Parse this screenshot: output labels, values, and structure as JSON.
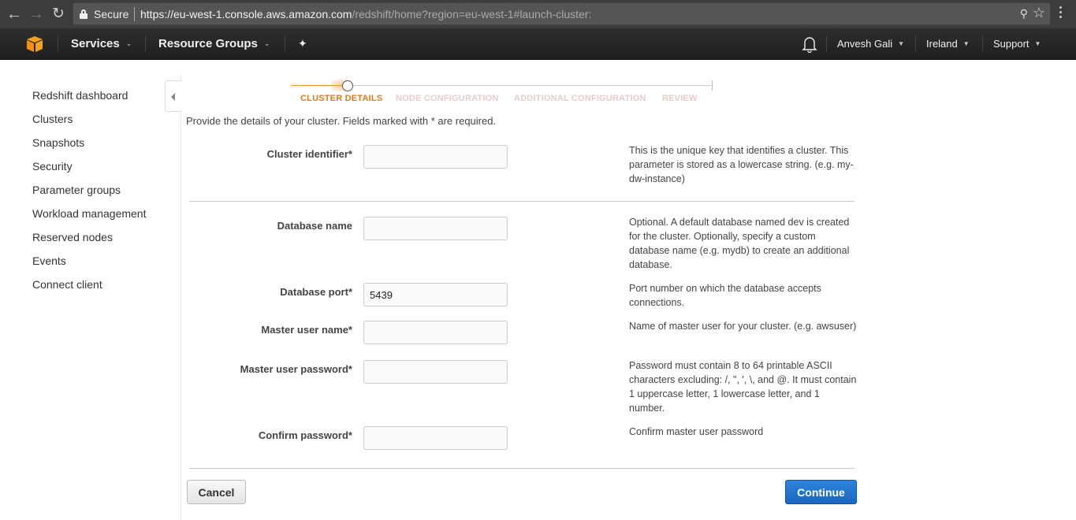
{
  "browser": {
    "secure_label": "Secure",
    "url_host": "https://eu-west-1.console.aws.amazon.com",
    "url_path": "/redshift/home?region=eu-west-1#launch-cluster:"
  },
  "topnav": {
    "services": "Services",
    "resource_groups": "Resource Groups",
    "user": "Anvesh Gali",
    "region": "Ireland",
    "support": "Support"
  },
  "sidebar": {
    "items": [
      {
        "label": "Redshift dashboard"
      },
      {
        "label": "Clusters"
      },
      {
        "label": "Snapshots"
      },
      {
        "label": "Security"
      },
      {
        "label": "Parameter groups"
      },
      {
        "label": "Workload management"
      },
      {
        "label": "Reserved nodes"
      },
      {
        "label": "Events"
      },
      {
        "label": "Connect client"
      }
    ]
  },
  "wizard": {
    "steps": [
      {
        "label": "CLUSTER DETAILS",
        "state": "active"
      },
      {
        "label": "NODE CONFIGURATION",
        "state": "inactive"
      },
      {
        "label": "ADDITIONAL CONFIGURATION",
        "state": "inactive"
      },
      {
        "label": "REVIEW",
        "state": "inactive"
      }
    ],
    "accent_color": "#e07b1c"
  },
  "form": {
    "intro": "Provide the details of your cluster. Fields marked with * are required.",
    "fields": [
      {
        "label": "Cluster identifier*",
        "value": "",
        "help": "This is the unique key that identifies a cluster. This parameter is stored as a lowercase string. (e.g. my-dw-instance)"
      },
      {
        "label": "Database name",
        "value": "",
        "help": "Optional. A default database named dev is created for the cluster. Optionally, specify a custom database name (e.g. mydb) to create an additional database."
      },
      {
        "label": "Database port*",
        "value": "5439",
        "help": "Port number on which the database accepts connections."
      },
      {
        "label": "Master user name*",
        "value": "",
        "help": "Name of master user for your cluster. (e.g. awsuser)"
      },
      {
        "label": "Master user password*",
        "value": "",
        "help": "Password must contain 8 to 64 printable ASCII characters excluding: /, \", ', \\, and @. It must contain 1 uppercase letter, 1 lowercase letter, and 1 number."
      },
      {
        "label": "Confirm password*",
        "value": "",
        "help": "Confirm master user password"
      }
    ]
  },
  "actions": {
    "cancel": "Cancel",
    "continue": "Continue",
    "primary_color": "#1f6fca"
  }
}
